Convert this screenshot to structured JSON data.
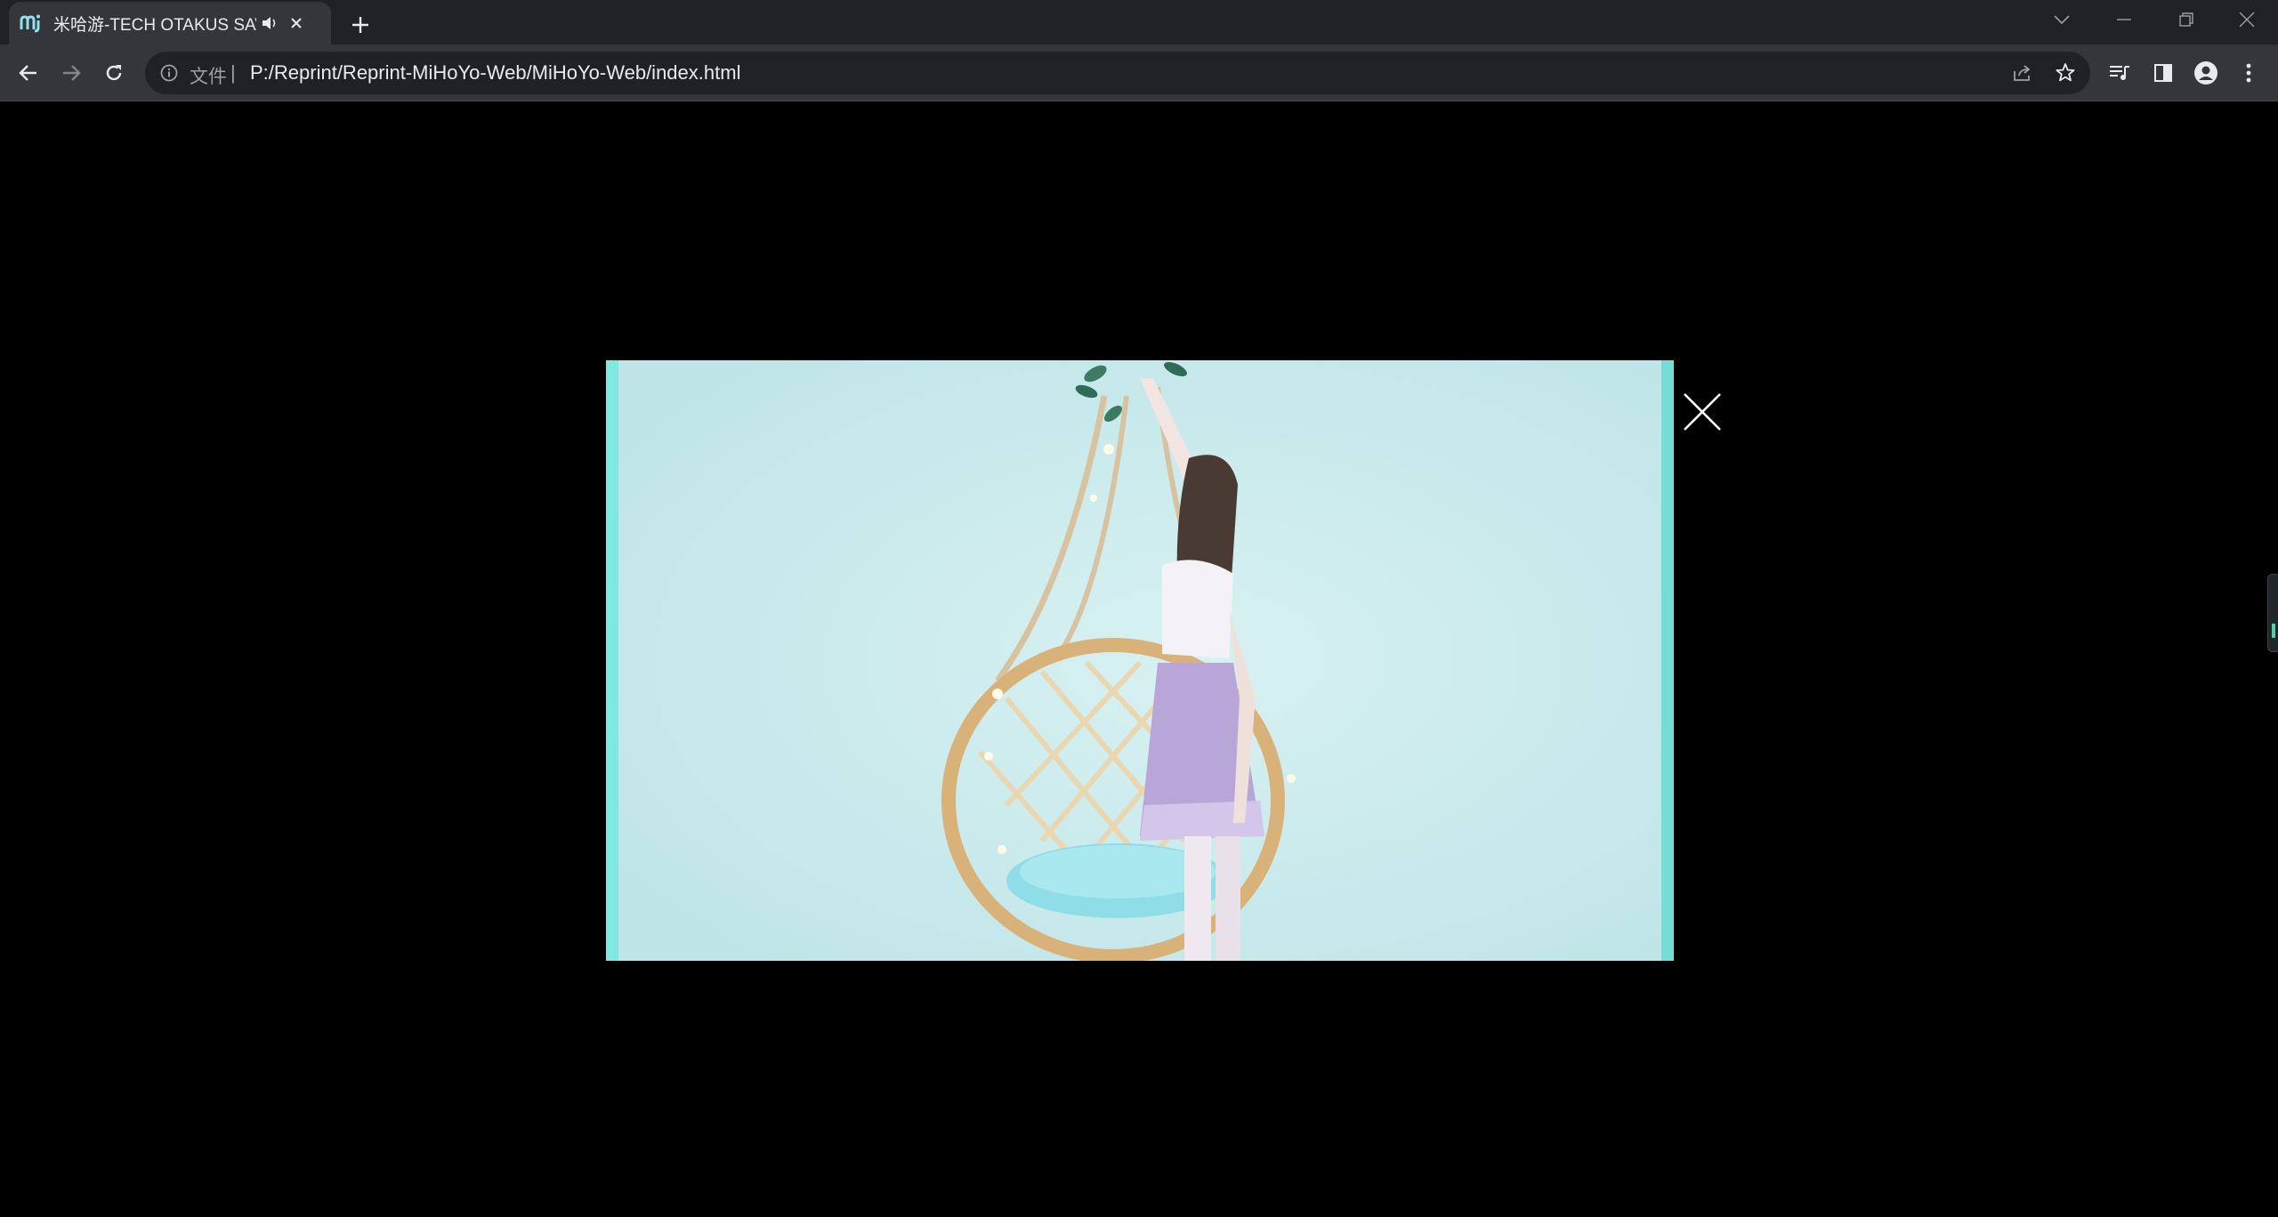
{
  "browser": {
    "tab": {
      "title": "米哈游-TECH OTAKUS SAVE THE WORLD",
      "favicon": "mihoyo-logo-icon",
      "audio_icon": "speaker-icon",
      "close_icon": "close-icon"
    },
    "new_tab_icon": "plus-icon",
    "window_controls": [
      "chevron-down-icon",
      "minimize-icon",
      "restore-icon",
      "close-icon"
    ],
    "address_bar": {
      "scheme_label": "文件",
      "separator": "|",
      "url": "P:/Reprint/Reprint-MiHoYo-Web/MiHoYo-Web/index.html"
    },
    "nav_icons": [
      "back-arrow-icon",
      "forward-arrow-icon",
      "reload-icon"
    ],
    "toolbar_icons": [
      "share-icon",
      "star-icon",
      "media-queue-icon",
      "side-panel-icon",
      "profile-icon",
      "kebab-menu-icon"
    ]
  },
  "page": {
    "background": "#000000",
    "video_modal": {
      "content": "video-frame",
      "close_icon": "close-x-icon"
    }
  },
  "colors": {
    "titlebar_bg": "#202124",
    "toolbar_bg": "#35363a",
    "omnibox_bg": "#202124",
    "text_primary": "#e8eaed",
    "text_secondary": "#9aa0a6",
    "video_sky": "#c9eaec",
    "accent_teal": "#7fe8e1"
  }
}
